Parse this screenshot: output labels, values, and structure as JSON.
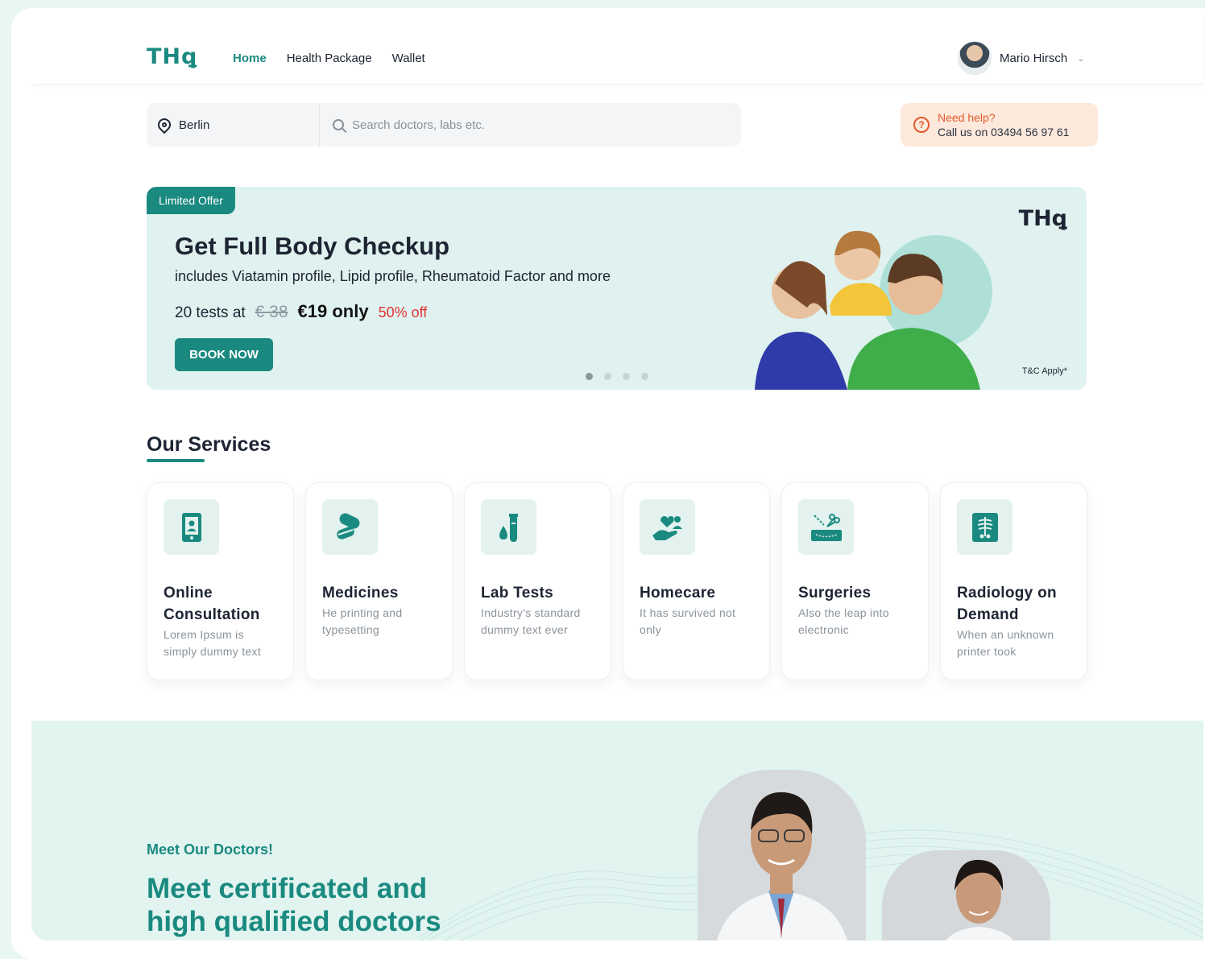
{
  "header": {
    "logo": "THꝗ",
    "nav": [
      "Home",
      "Health Package",
      "Wallet"
    ],
    "active_nav": "Home",
    "user_name": "Mario Hirsch"
  },
  "search": {
    "location": "Berlin",
    "placeholder": "Search doctors, labs etc."
  },
  "help": {
    "title": "Need help?",
    "phone": "Call us on 03494 56 97 61"
  },
  "banner": {
    "badge": "Limited Offer",
    "title": "Get Full Body Checkup",
    "subtitle": "includes Viatamin profile, Lipid profile, Rheumatoid Factor and more",
    "tests_prefix": "20 tests at",
    "old_price": "€ 38",
    "new_price": "€19 only",
    "discount": "50% off",
    "button": "BOOK NOW",
    "logo": "THꝗ",
    "terms": "T&C Apply*",
    "slides": 4,
    "active_slide": 1
  },
  "services": {
    "title": "Our Services",
    "items": [
      {
        "title": "Online Consultation",
        "desc": "Lorem Ipsum is simply dummy text",
        "icon": "phone-doctor-icon"
      },
      {
        "title": "Medicines",
        "desc": "He printing and typesetting",
        "icon": "pills-icon"
      },
      {
        "title": "Lab Tests",
        "desc": "Industry's standard dummy text ever",
        "icon": "test-tube-icon"
      },
      {
        "title": "Homecare",
        "desc": "It has survived not only",
        "icon": "care-hand-icon"
      },
      {
        "title": "Surgeries",
        "desc": "Also the leap into electronic",
        "icon": "scissors-icon"
      },
      {
        "title": "Radiology on Demand",
        "desc": "When an unknown printer took",
        "icon": "xray-icon"
      }
    ]
  },
  "doctors": {
    "eyebrow": "Meet Our Doctors!",
    "heading": "Meet certificated and high qualified doctors"
  },
  "colors": {
    "brand": "#1a8a80",
    "accent_orange": "#e4582d",
    "discount_red": "#e03434"
  }
}
